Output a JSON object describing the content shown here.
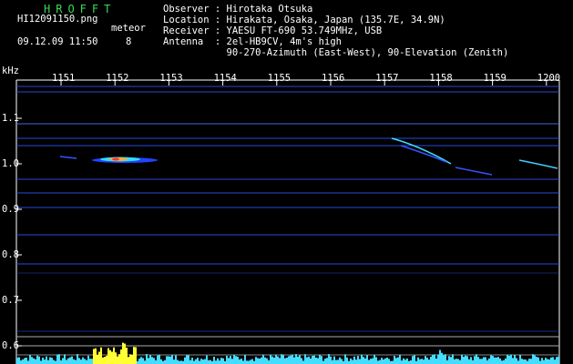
{
  "logo": "HROFFT",
  "file_name": "HI12091150.png",
  "meteor_label": "meteor",
  "meteor_count": "8",
  "date_time": "09.12.09 11:50",
  "header": {
    "observer": "Observer : Hirotaka Otsuka",
    "location": "Location : Hirakata, Osaka, Japan (135.7E, 34.9N)",
    "receiver": "Receiver : YAESU FT-690 53.749MHz, USB",
    "antenna": "Antenna  : 2el-HB9CV, 4m's high",
    "antenna2": "           90-270-Azimuth (East-West), 90-Elevation (Zenith)"
  },
  "y_unit": "kHz",
  "x_ticks": [
    "1151",
    "1152",
    "1153",
    "1154",
    "1155",
    "1156",
    "1157",
    "1158",
    "1159",
    "1200"
  ],
  "y_ticks": [
    "1.1",
    "1.0",
    "0.9",
    "0.8",
    "0.7",
    "0.6"
  ],
  "colors": {
    "bg": "#000000",
    "text": "#ffffff",
    "logo": "#33dd55",
    "trace": "#3355ff",
    "signal": "#44ddff",
    "peak": "#ffff33"
  }
}
